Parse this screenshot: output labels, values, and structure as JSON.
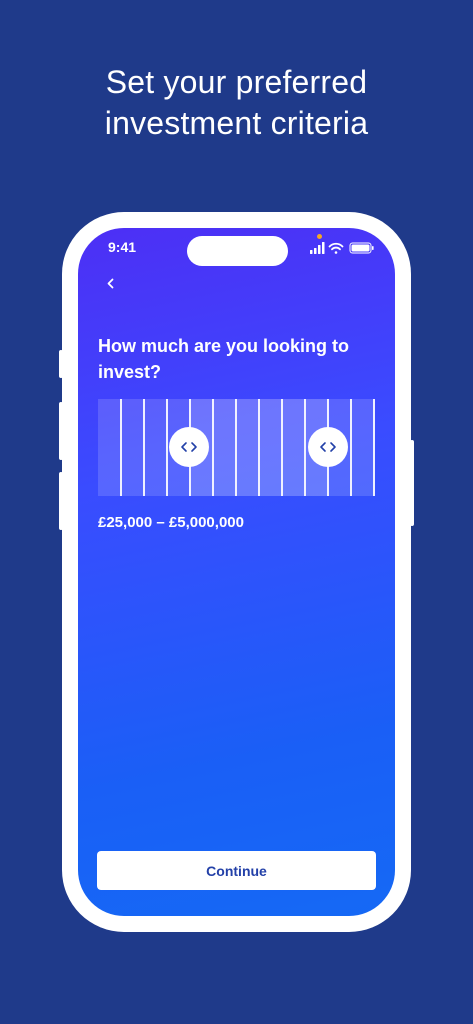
{
  "headline": {
    "line1": "Set your preferred",
    "line2": "investment criteria"
  },
  "status_bar": {
    "time": "9:41",
    "icons": [
      "signal-icon",
      "wifi-icon",
      "battery-icon"
    ],
    "indicator_color": "#f5a623"
  },
  "screen": {
    "back_icon": "chevron-left-icon",
    "question": "How much are you looking to invest?",
    "range": {
      "value_text": "£25,000 – £5,000,000",
      "tick_count": 12,
      "low_handle_fraction": 0.33,
      "high_handle_fraction": 0.83,
      "handle_icon": "chevron-left-right-icon"
    },
    "continue_label": "Continue"
  },
  "colors": {
    "background": "#1f3a8a",
    "gradient_top": "#4d2ff5",
    "gradient_bottom": "#1569f5",
    "button_text": "#2340a8"
  }
}
